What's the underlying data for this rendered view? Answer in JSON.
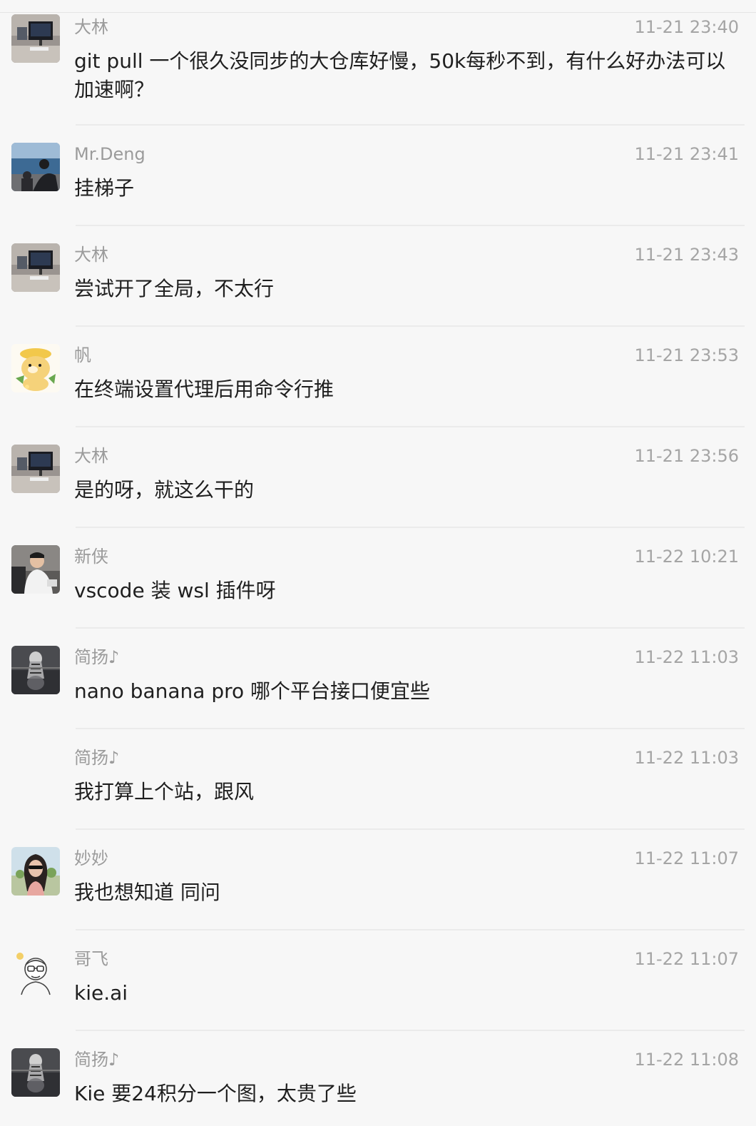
{
  "messages": [
    {
      "sender": "大林",
      "time": "11-21 23:40",
      "text": "git pull 一个很久没同步的大仓库好慢，50k每秒不到，有什么好办法可以加速啊？",
      "avatar": "desk-monitor-avatar"
    },
    {
      "sender": "Mr.Deng",
      "time": "11-21 23:41",
      "text": "挂梯子",
      "avatar": "seaside-person-avatar"
    },
    {
      "sender": "大林",
      "time": "11-21 23:43",
      "text": "尝试开了全局，不太行",
      "avatar": "desk-monitor-avatar"
    },
    {
      "sender": "帆",
      "time": "11-21 23:53",
      "text": "在终端设置代理后用命令行推",
      "avatar": "cartoon-dog-avatar"
    },
    {
      "sender": "大林",
      "time": "11-21 23:56",
      "text": "是的呀，就这么干的",
      "avatar": "desk-monitor-avatar"
    },
    {
      "sender": "新侠",
      "time": "11-22 10:21",
      "text": "vscode 装 wsl 插件呀",
      "avatar": "man-white-shirt-avatar"
    },
    {
      "sender": "简扬♪",
      "time": "11-22 11:03",
      "text": "nano banana pro 哪个平台接口便宜些",
      "avatar": "tiger-avatar"
    },
    {
      "sender": "简扬♪",
      "time": "11-22 11:03",
      "text": "我打算上个站，跟风",
      "avatar": ""
    },
    {
      "sender": "妙妙",
      "time": "11-22 11:07",
      "text": "我也想知道 同问",
      "avatar": "woman-sunglasses-avatar"
    },
    {
      "sender": "哥飞",
      "time": "11-22 11:07",
      "text": "kie.ai",
      "avatar": "glasses-sketch-avatar"
    },
    {
      "sender": "简扬♪",
      "time": "11-22 11:08",
      "text": "Kie 要24积分一个图，太贵了些",
      "avatar": "tiger-avatar"
    }
  ]
}
